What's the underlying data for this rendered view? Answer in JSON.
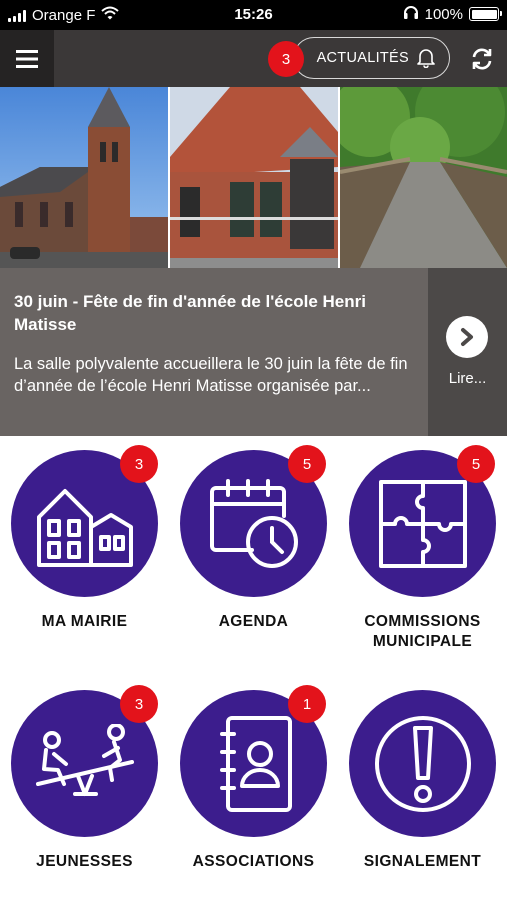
{
  "status_bar": {
    "carrier": "Orange F",
    "time": "15:26",
    "battery": "100%",
    "icons": [
      "signal-icon",
      "wifi-icon",
      "headphones-icon",
      "battery-icon"
    ]
  },
  "header": {
    "news_label": "ACTUALITÉS",
    "news_badge": "3",
    "icons": [
      "menu-icon",
      "bell-icon",
      "refresh-icon"
    ]
  },
  "news": {
    "title": "30 juin - Fête de fin d'année de l'école Henri Matisse",
    "summary": "La salle polyvalente accueillera le 30 juin la fête de fin d’année de l’école Henri Matisse organisée par...",
    "read_more": "Lire..."
  },
  "tiles": [
    {
      "label": "MA MAIRIE",
      "badge": "3",
      "icon": "town-hall-icon"
    },
    {
      "label": "AGENDA",
      "badge": "5",
      "icon": "calendar-clock-icon"
    },
    {
      "label_line1": "COMMISSIONS",
      "label_line2": "MUNICIPALE",
      "badge": "5",
      "icon": "puzzle-icon"
    },
    {
      "label": "JEUNESSES",
      "badge": "3",
      "icon": "seesaw-icon"
    },
    {
      "label": "ASSOCIATIONS",
      "badge": "1",
      "icon": "address-book-icon"
    },
    {
      "label": "SIGNALEMENT",
      "badge": "",
      "icon": "alert-icon"
    }
  ],
  "colors": {
    "tile_purple": "#3c1d8d",
    "badge_red": "#e3131b",
    "header_dark": "#3b3838",
    "news_card": "#696462"
  }
}
